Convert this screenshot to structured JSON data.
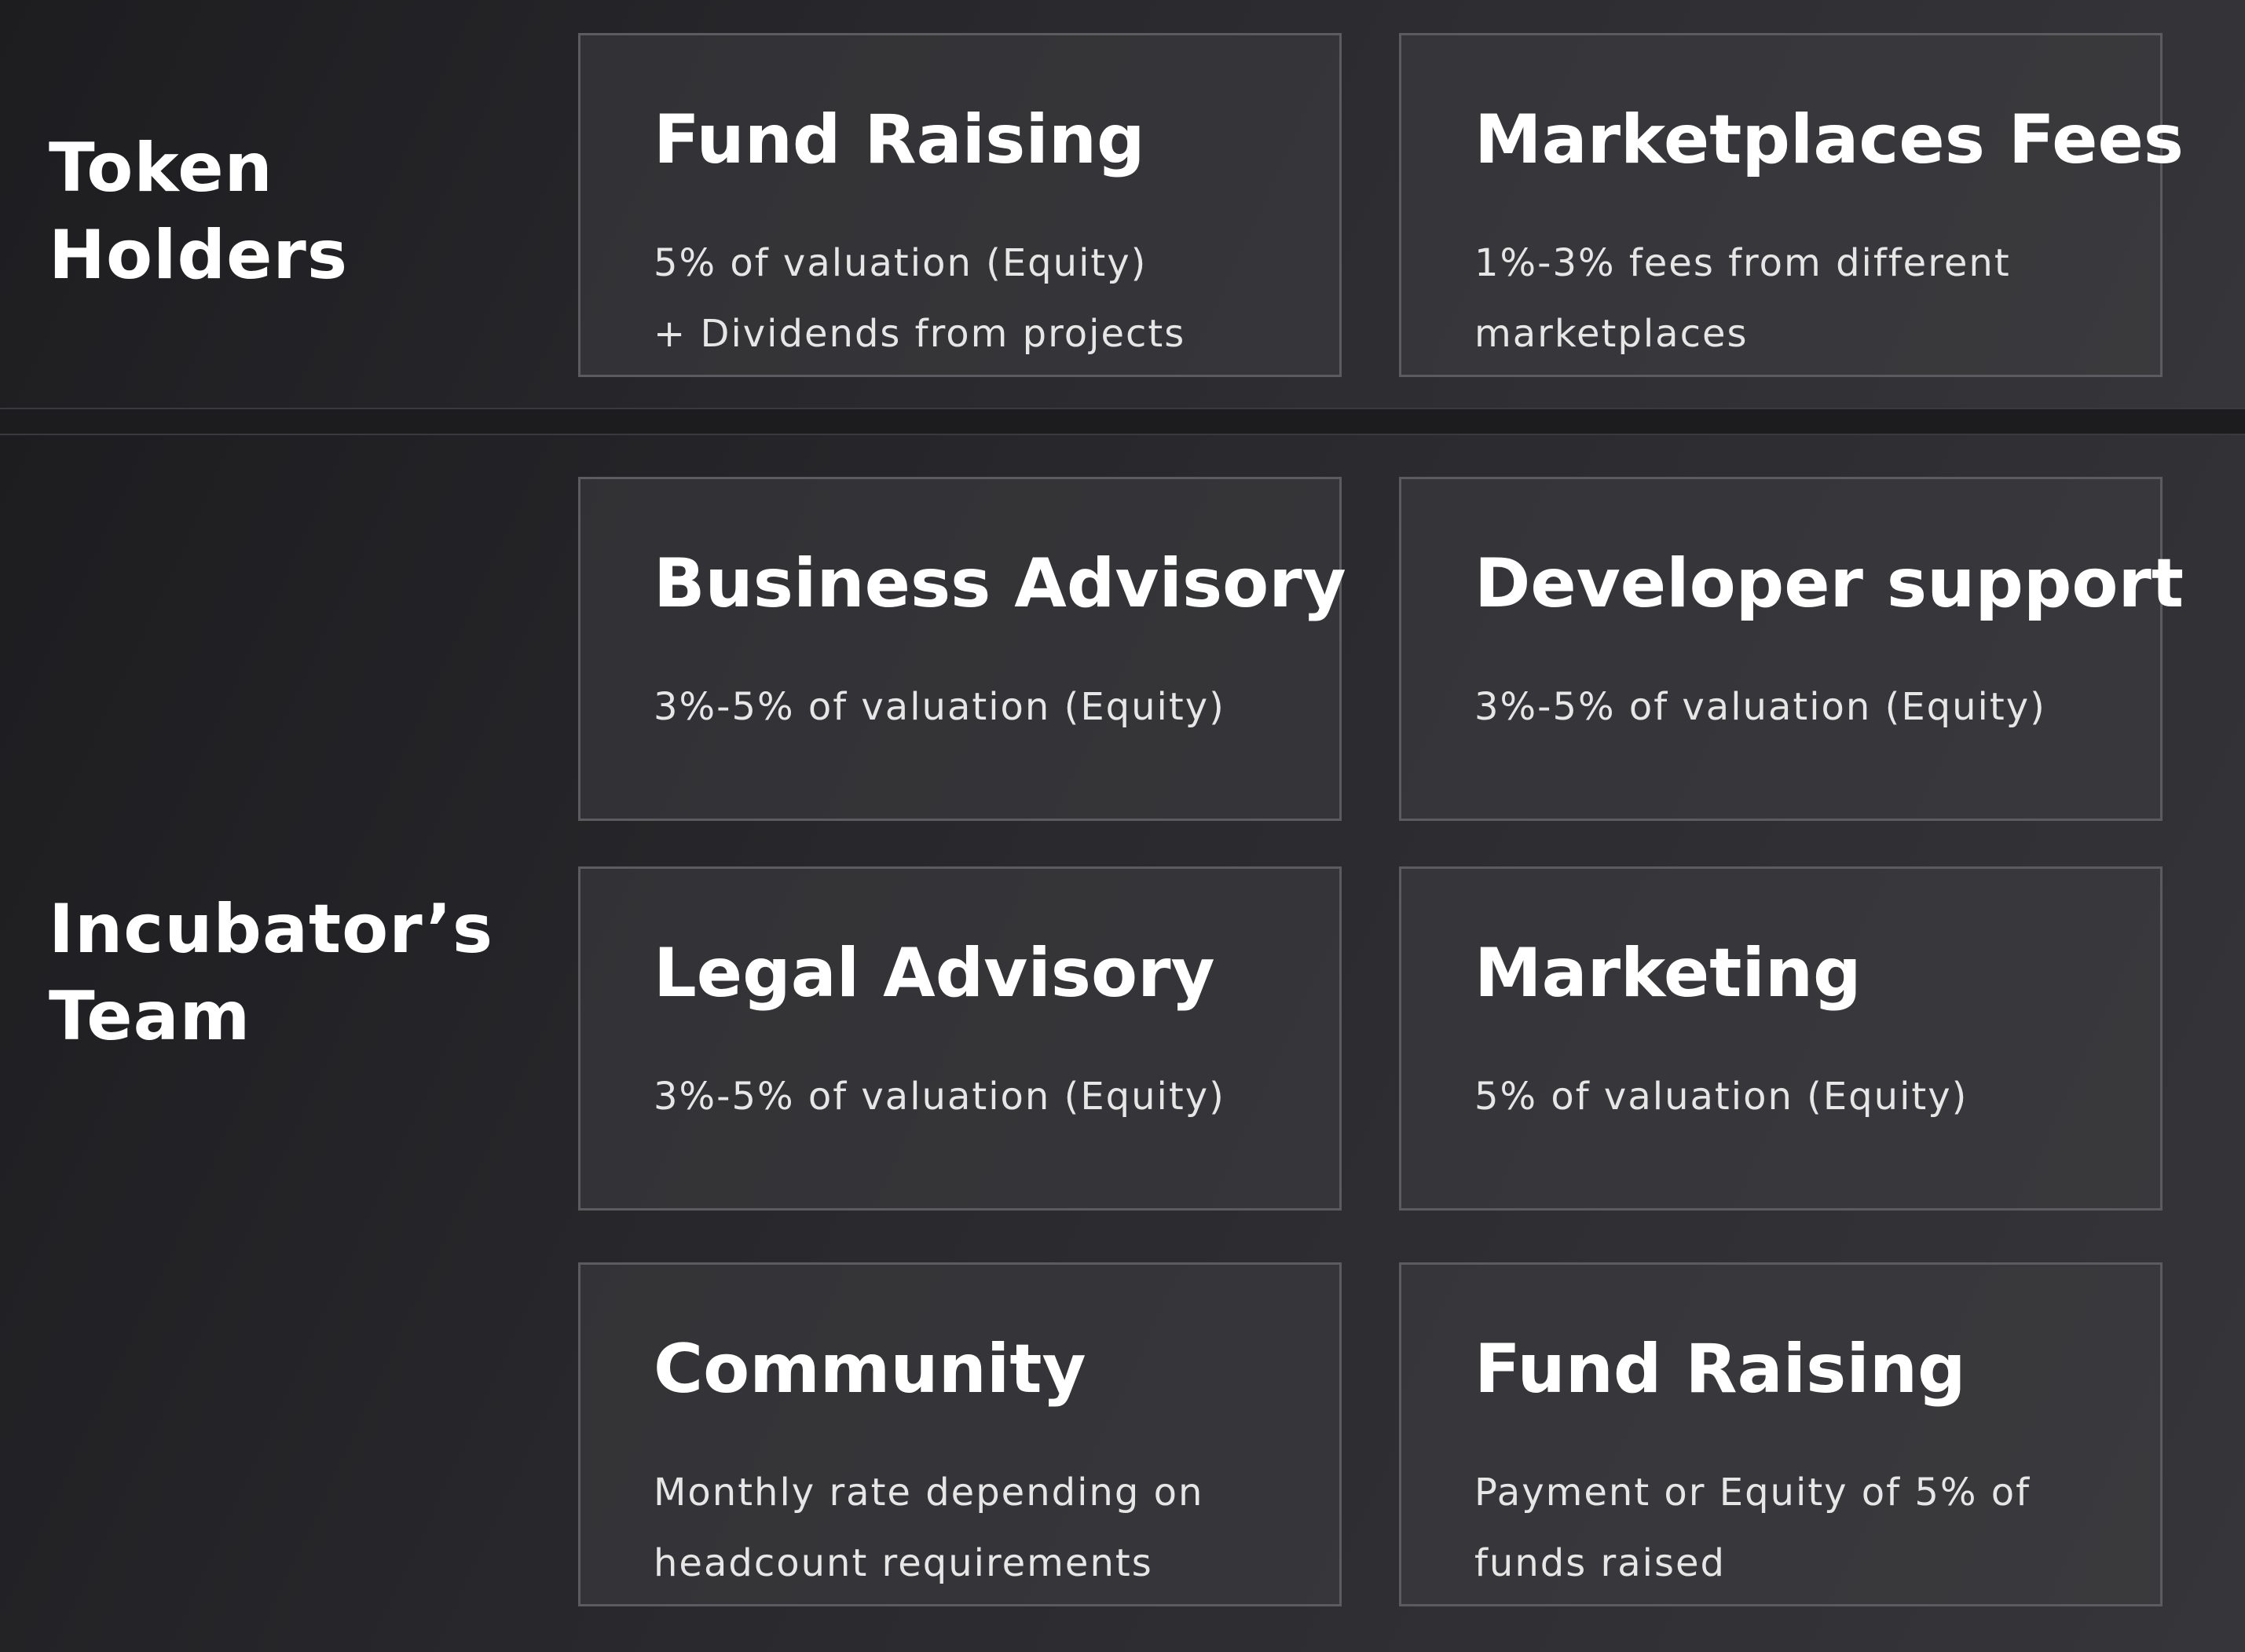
{
  "token_holders": {
    "title": "Token\nHolders",
    "cards": [
      {
        "title": "Fund Raising",
        "description": "5% of valuation (Equity)\n+ Dividends from projects"
      },
      {
        "title": "Marketplaces Fees",
        "description": "1%-3% fees from different\nmarketplaces"
      }
    ]
  },
  "incubator_team": {
    "title": "Incubator’s\nTeam",
    "cards": [
      {
        "title": "Business Advisory",
        "description": "3%-5% of valuation (Equity)"
      },
      {
        "title": "Developer support",
        "description": "3%-5% of valuation (Equity)"
      },
      {
        "title": "Legal Advisory",
        "description": "3%-5% of valuation (Equity)"
      },
      {
        "title": "Marketing",
        "description": "5% of valuation (Equity)"
      },
      {
        "title": "Community",
        "description": "Monthly rate depending on\nheadcount requirements"
      },
      {
        "title": "Fund Raising",
        "description": "Payment or Equity of 5% of\nfunds raised"
      }
    ]
  },
  "colors": {
    "background_dark": "#1c1c1f",
    "card_border": "#5c5c60",
    "text_primary": "#ffffff",
    "text_secondary": "#e6e6e6"
  }
}
